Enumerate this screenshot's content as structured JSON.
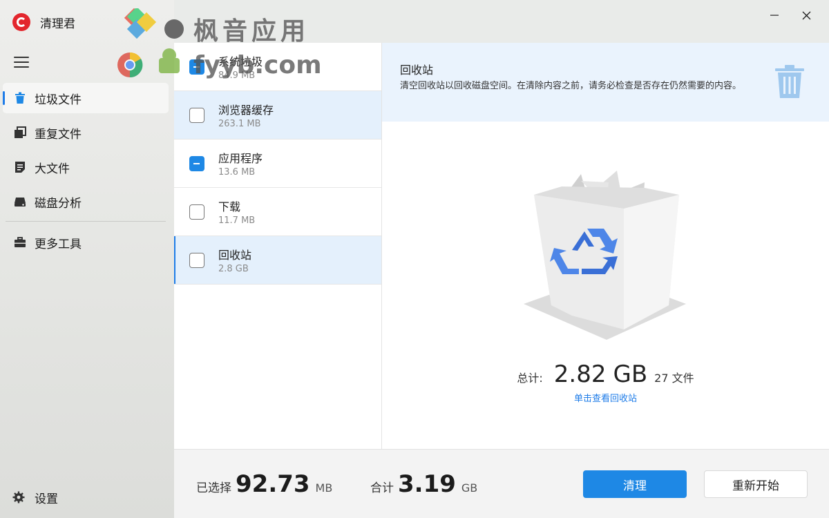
{
  "app": {
    "name": "清理君",
    "logo": "cleaner-logo"
  },
  "watermark": {
    "line1": "枫音应用",
    "line2": "fyyb.com"
  },
  "sidebar": {
    "menu_icon": "hamburger-icon",
    "items": [
      {
        "label": "垃圾文件",
        "icon": "trash-icon",
        "active": true
      },
      {
        "label": "重复文件",
        "icon": "duplicate-icon",
        "active": false
      },
      {
        "label": "大文件",
        "icon": "file-icon",
        "active": false
      },
      {
        "label": "磁盘分析",
        "icon": "disk-icon",
        "active": false
      }
    ],
    "extra_item": {
      "label": "更多工具",
      "icon": "toolbox-icon"
    },
    "settings": {
      "label": "设置",
      "icon": "gear-icon"
    }
  },
  "window": {
    "minimize_icon": "minimize-icon",
    "close_icon": "close-icon"
  },
  "categories": [
    {
      "name": "系统垃圾",
      "size": "84.9 MB",
      "state": "partial"
    },
    {
      "name": "浏览器缓存",
      "size": "263.1 MB",
      "state": "unchecked"
    },
    {
      "name": "应用程序",
      "size": "13.6 MB",
      "state": "partial"
    },
    {
      "name": "下载",
      "size": "11.7 MB",
      "state": "unchecked"
    },
    {
      "name": "回收站",
      "size": "2.8 GB",
      "state": "unchecked"
    }
  ],
  "detail": {
    "title": "回收站",
    "description": "清空回收站以回收磁盘空间。在清除内容之前，请务必检查是否存在仍然需要的内容。",
    "icon": "recycle-bin-icon",
    "total_label": "总计:",
    "total_value": "2.82",
    "total_unit": "GB",
    "file_count": "27 文件",
    "link": "单击查看回收站"
  },
  "footer": {
    "selected_label": "已选择",
    "selected_value": "92.73",
    "selected_unit": "MB",
    "total_label": "合计",
    "total_value": "3.19",
    "total_unit": "GB",
    "clean_button": "清理",
    "restart_button": "重新开始"
  },
  "colors": {
    "accent": "#1e88e5",
    "link": "#1e7ce8",
    "logo": "#e3262d",
    "highlight": "#e4f0fc"
  }
}
